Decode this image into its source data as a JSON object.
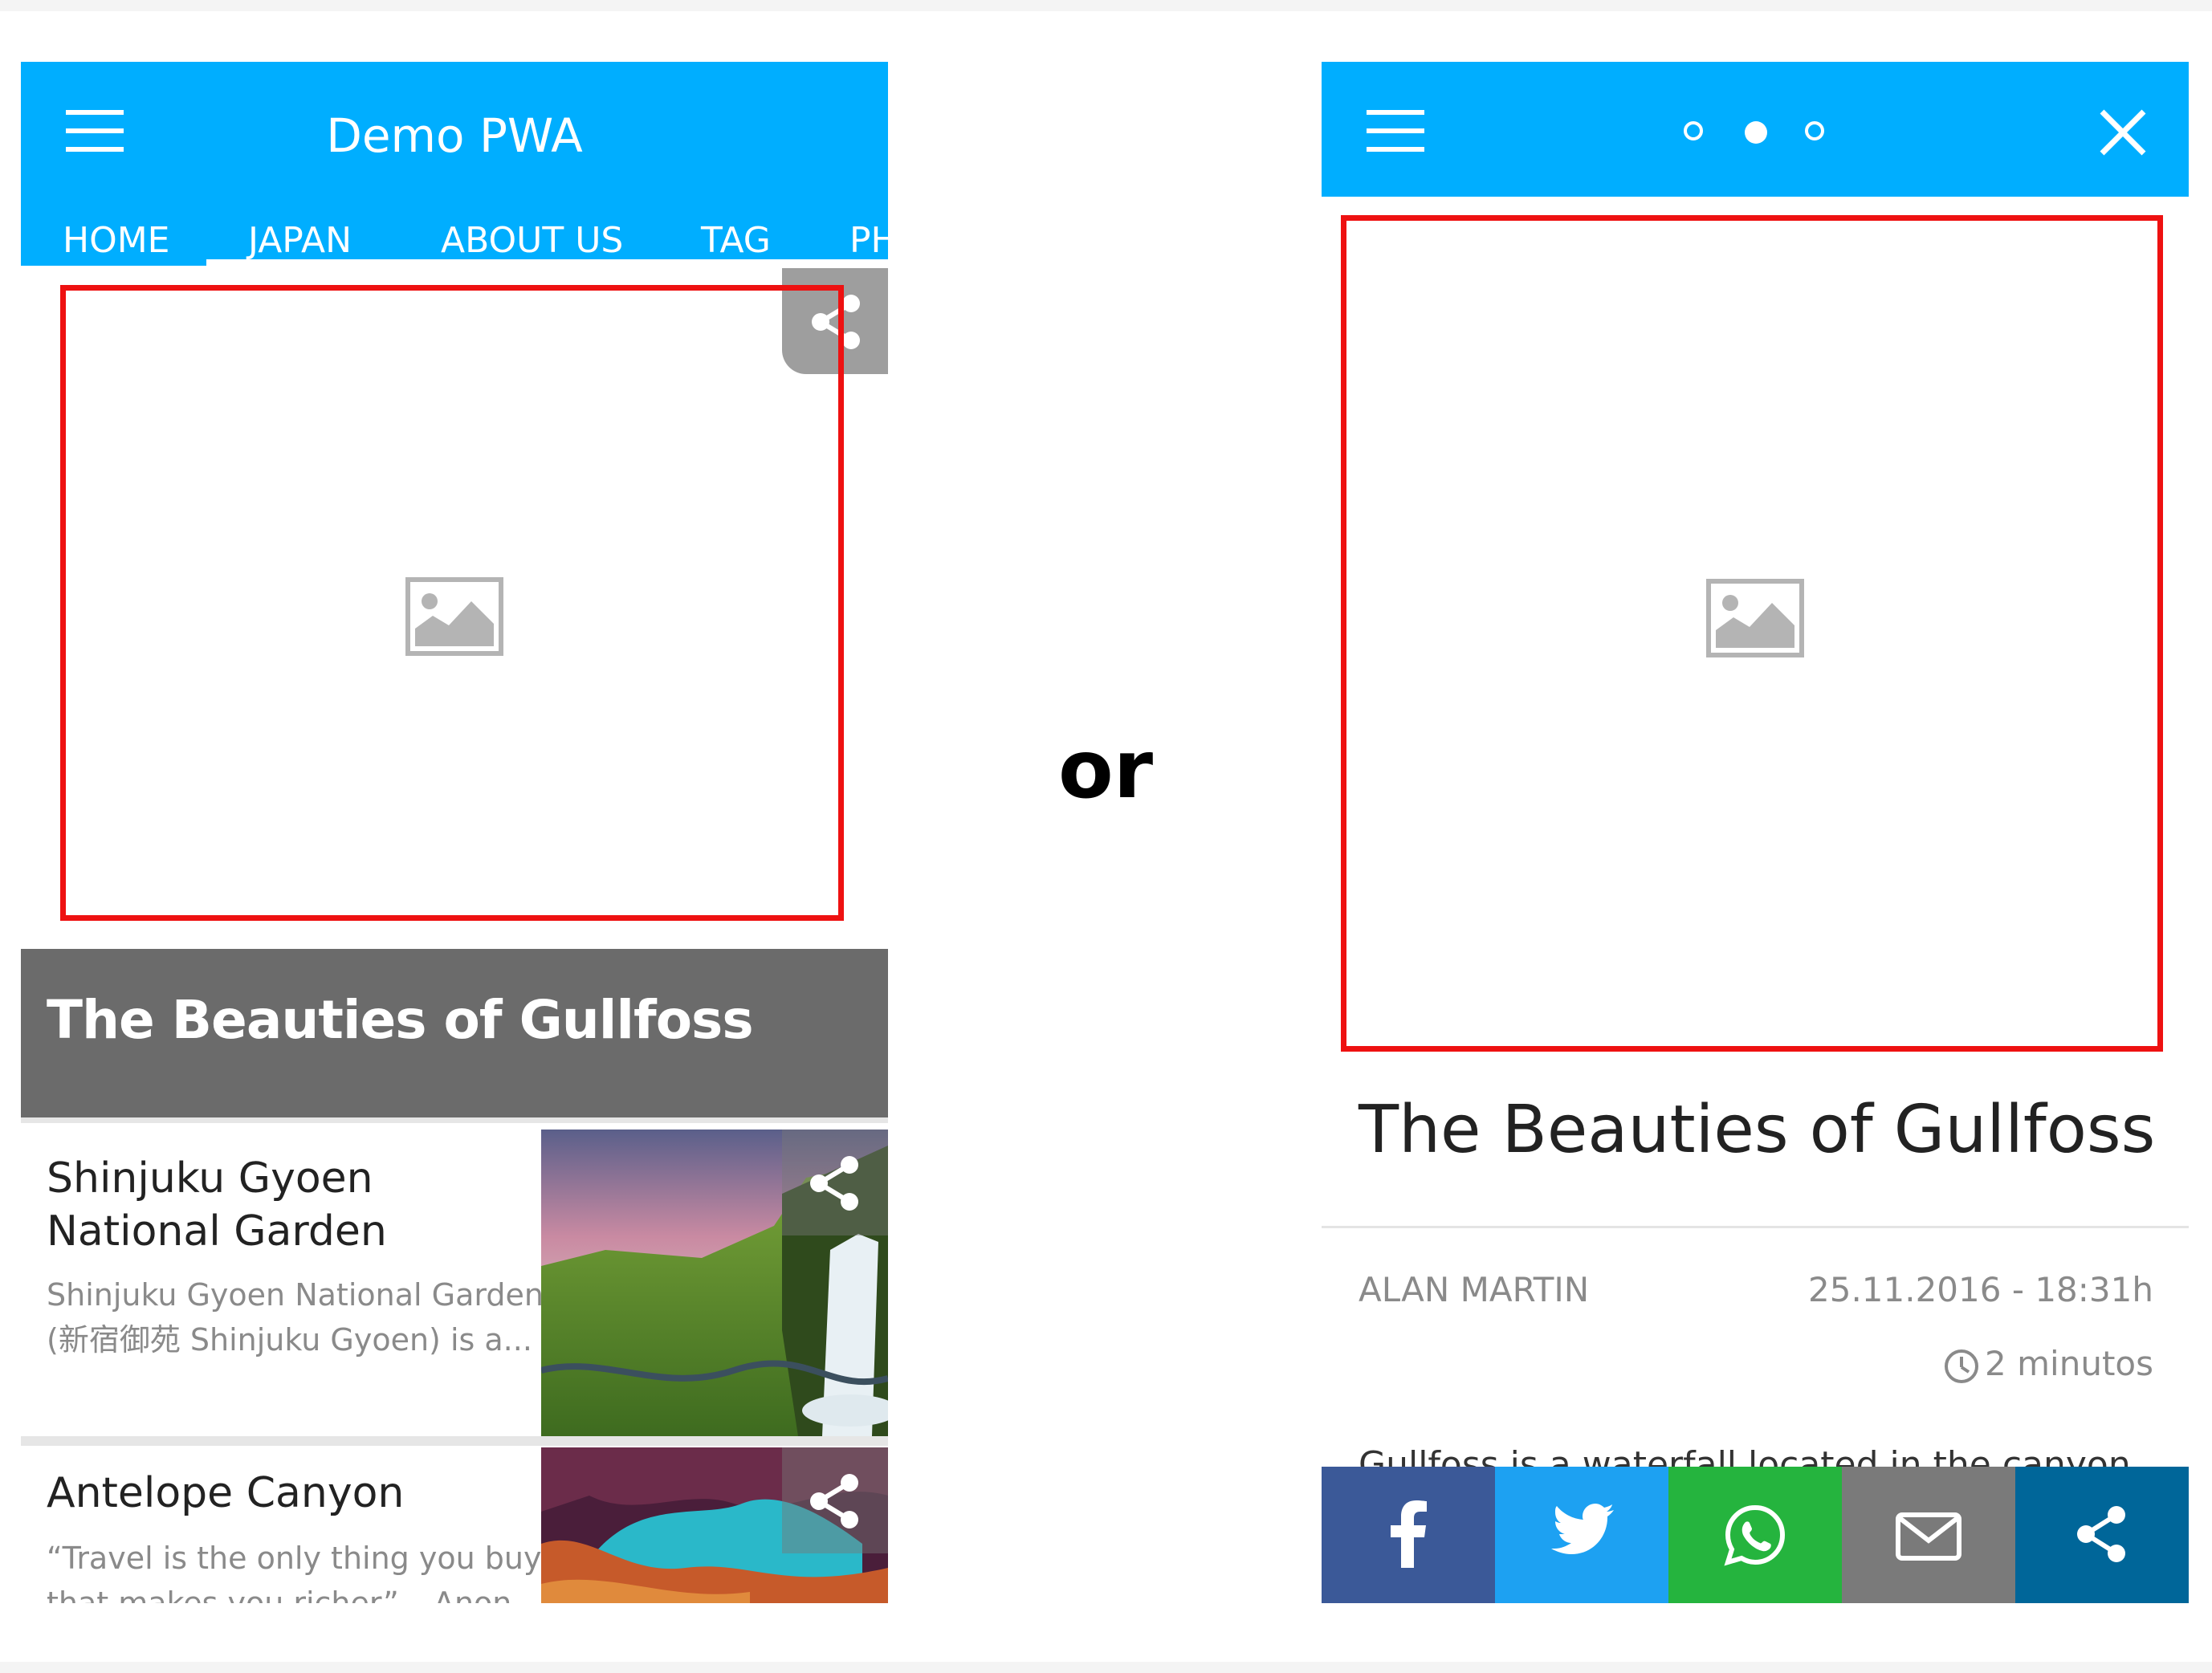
{
  "left_screen": {
    "app_title": "Demo PWA",
    "tabs": [
      {
        "label": "HOME"
      },
      {
        "label": "JAPAN"
      },
      {
        "label": "ABOUT US"
      },
      {
        "label": "TAG"
      },
      {
        "label": "PH"
      }
    ],
    "active_tab": "HOME",
    "featured_title": "The Beauties of Gullfoss",
    "articles": [
      {
        "title_line1": "Shinjuku Gyoen",
        "title_line2": "National Garden",
        "desc_line1": "Shinjuku Gyoen National Garden",
        "desc_line2": "(新宿御苑 Shinjuku Gyoen) is a..."
      },
      {
        "title_line1": "Antelope Canyon",
        "desc_line1": "“Travel is the only thing you buy",
        "desc_line2": "that makes you richer” – Anon"
      }
    ]
  },
  "separator_text": "or",
  "right_screen": {
    "pager_dots": 3,
    "pager_active": 2,
    "article_title": "The Beauties of Gullfoss",
    "author": "ALAN MARTIN",
    "date": "25.11.2016 - 18:31h",
    "read_time": "2 minutos",
    "body_snippet": "Gullfoss is a waterfall located in the canyon",
    "share_buttons": [
      {
        "name": "facebook",
        "icon": "facebook-icon",
        "color": "#3b5998"
      },
      {
        "name": "twitter",
        "icon": "twitter-icon",
        "color": "#1da1f2"
      },
      {
        "name": "whatsapp",
        "icon": "whatsapp-icon",
        "color": "#25b43e"
      },
      {
        "name": "email",
        "icon": "mail-icon",
        "color": "#7a7a7a"
      },
      {
        "name": "share",
        "icon": "share-icon",
        "color": "#006699"
      }
    ]
  },
  "colors": {
    "appbar": "#00aeff",
    "highlight_border": "#ee1111",
    "banner": "#6b6b6b"
  }
}
